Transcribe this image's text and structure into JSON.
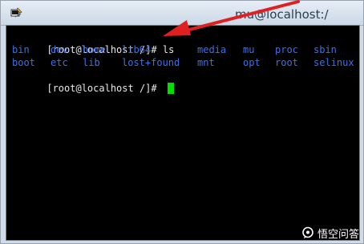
{
  "window": {
    "title": "mu@localhost:/",
    "app_icon": "putty-terminal-icon"
  },
  "terminal": {
    "line1": {
      "prompt": "[root@localhost /]# ",
      "command": "ls"
    },
    "listing_row1": [
      "bin",
      "dev",
      "home",
      "lib64",
      "media",
      "mu",
      "proc",
      "sbin"
    ],
    "listing_row2": [
      "boot",
      "etc",
      "lib",
      "lost+found",
      "mnt",
      "opt",
      "root",
      "selinux"
    ],
    "line4": {
      "prompt": "[root@localhost /]# "
    },
    "colors": {
      "background": "#000000",
      "text": "#e8e8e8",
      "directory": "#3c6ff0",
      "cursor": "#00e000"
    }
  },
  "annotation": {
    "arrow_color": "#e02020"
  },
  "watermark": {
    "text": "悟空问答",
    "icon": "chat-bubble-icon"
  }
}
